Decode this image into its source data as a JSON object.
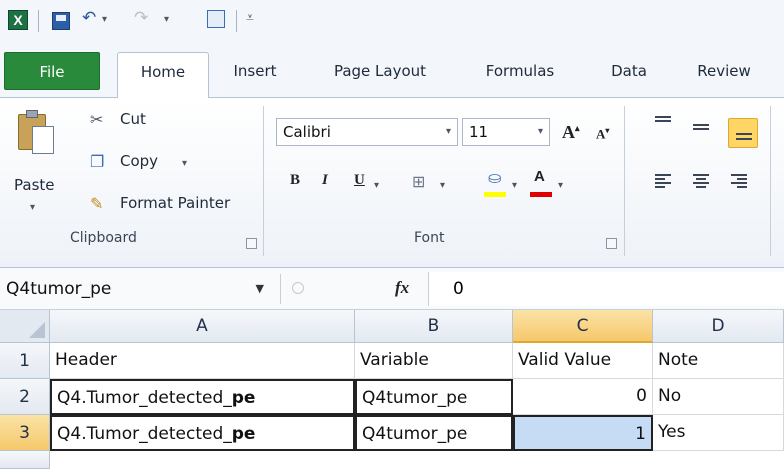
{
  "quick_access": {
    "icons": [
      "excel-icon",
      "save-icon",
      "undo-icon",
      "redo-icon",
      "form-icon",
      "customize-qat-icon"
    ]
  },
  "tabs": [
    {
      "label": "File"
    },
    {
      "label": "Home"
    },
    {
      "label": "Insert"
    },
    {
      "label": "Page Layout"
    },
    {
      "label": "Formulas"
    },
    {
      "label": "Data"
    },
    {
      "label": "Review"
    }
  ],
  "clipboard": {
    "paste_label": "Paste",
    "cut_label": "Cut",
    "copy_label": "Copy",
    "format_painter_label": "Format Painter",
    "group_label": "Clipboard"
  },
  "font": {
    "font_name": "Calibri",
    "font_size": "11",
    "bold_glyph": "B",
    "italic_glyph": "I",
    "underline_glyph": "U",
    "grow_glyph": "A",
    "shrink_glyph": "A",
    "font_color_glyph": "A",
    "highlight_color": "#ffff00",
    "font_color": "#e00000",
    "group_label": "Font"
  },
  "formula_bar": {
    "name_box": "Q4tumor_pe",
    "fx_label": "fx",
    "value": "0"
  },
  "sheet": {
    "columns": [
      "A",
      "B",
      "C",
      "D"
    ],
    "selected_column": "C",
    "rows": [
      {
        "num": "1",
        "a": "Header",
        "a_bold": "",
        "b": "Variable",
        "c": "Valid Value",
        "d": "Note"
      },
      {
        "num": "2",
        "a": "Q4.Tumor_detected_",
        "a_bold": "pe",
        "b": "Q4tumor_pe",
        "c": "0",
        "d": "No"
      },
      {
        "num": "3",
        "a": "Q4.Tumor_detected_",
        "a_bold": "pe",
        "b": "Q4tumor_pe",
        "c": "1",
        "d": "Yes"
      }
    ],
    "selected_row": "3"
  },
  "colors": {
    "file_tab": "#2a8a3c",
    "selection_fill": "#c6dcf5",
    "header_highlight": "#f5c86b"
  }
}
